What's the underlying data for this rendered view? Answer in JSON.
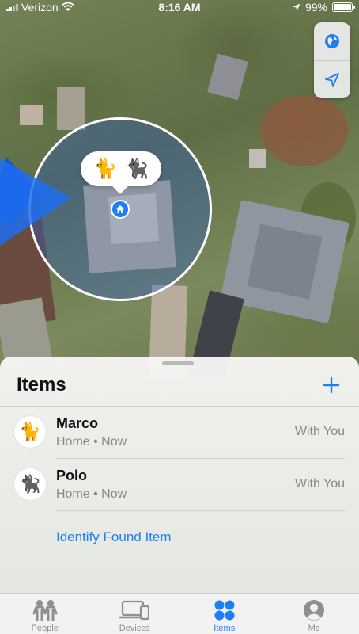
{
  "status_bar": {
    "carrier": "Verizon",
    "time": "8:16 AM",
    "battery": "99%",
    "battery_level": 0.99
  },
  "map": {
    "buttons": [
      {
        "icon": "globe-icon"
      },
      {
        "icon": "location-arrow-icon"
      }
    ],
    "pin_items": [
      "🐈",
      "🐈‍⬛"
    ],
    "home_icon": "house-icon"
  },
  "sheet": {
    "title": "Items",
    "add_icon": "plus-icon",
    "items": [
      {
        "name": "Marco",
        "subtitle": "Home • Now",
        "status": "With You",
        "avatar": "🐈"
      },
      {
        "name": "Polo",
        "subtitle": "Home • Now",
        "status": "With You",
        "avatar": "🐈‍⬛"
      }
    ],
    "identify_label": "Identify Found Item"
  },
  "tabbar": {
    "tabs": [
      {
        "label": "People",
        "icon": "people-icon",
        "active": false
      },
      {
        "label": "Devices",
        "icon": "devices-icon",
        "active": false
      },
      {
        "label": "Items",
        "icon": "items-icon",
        "active": true
      },
      {
        "label": "Me",
        "icon": "me-icon",
        "active": false
      }
    ]
  },
  "colors": {
    "accent": "#1d7ff3",
    "secondary_text": "#888888"
  }
}
